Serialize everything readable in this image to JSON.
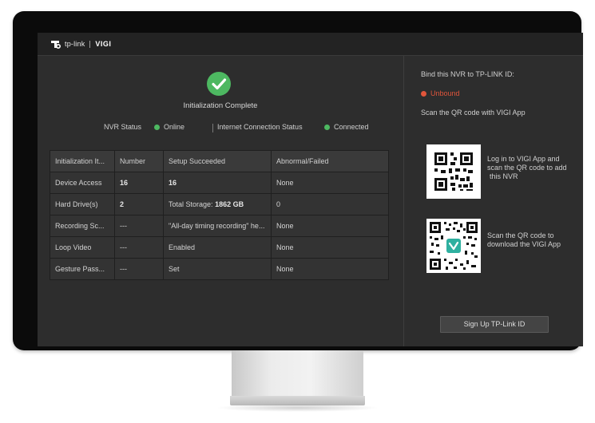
{
  "brand": {
    "logo_text": "tp-link",
    "product": "VIGI"
  },
  "main": {
    "init_title": "Initialization Complete",
    "nvr_status_label": "NVR Status",
    "nvr_status_value": "Online",
    "internet_label": "Internet Connection Status",
    "internet_value": "Connected",
    "status_color": "#4db861"
  },
  "table": {
    "headers": [
      "Initialization It...",
      "Number",
      "Setup Succeeded",
      "Abnormal/Failed"
    ],
    "rows": [
      {
        "item": "Device Access",
        "number": "16",
        "setup": "16",
        "failed": "None"
      },
      {
        "item": "Hard Drive(s)",
        "number": "2",
        "setup_label": "Total Storage:",
        "setup_value": "1862 GB",
        "failed": "0"
      },
      {
        "item": "Recording Sc...",
        "number": "---",
        "setup": "\"All-day timing recording\" he...",
        "failed": "None"
      },
      {
        "item": "Loop Video",
        "number": "---",
        "setup": "Enabled",
        "failed": "None"
      },
      {
        "item": "Gesture Pass...",
        "number": "---",
        "setup": "Set",
        "failed": "None"
      }
    ]
  },
  "side": {
    "bind_label": "Bind this NVR to TP-LINK ID:",
    "bind_status": "Unbound",
    "bind_status_color": "#e0553b",
    "scan_label": "Scan the QR code with VIGI App",
    "qr1_caption": "Log in to VIGI App and scan the QR code to add this NVR",
    "qr1_caption_l1": "Log in to VIGI App and",
    "qr1_caption_l2": "scan the QR code to add",
    "qr1_caption_l3": "this NVR",
    "qr2_caption_l1": "Scan the QR code to",
    "qr2_caption_l2": "download the VIGI App",
    "signup_label": "Sign Up TP-Link ID"
  }
}
